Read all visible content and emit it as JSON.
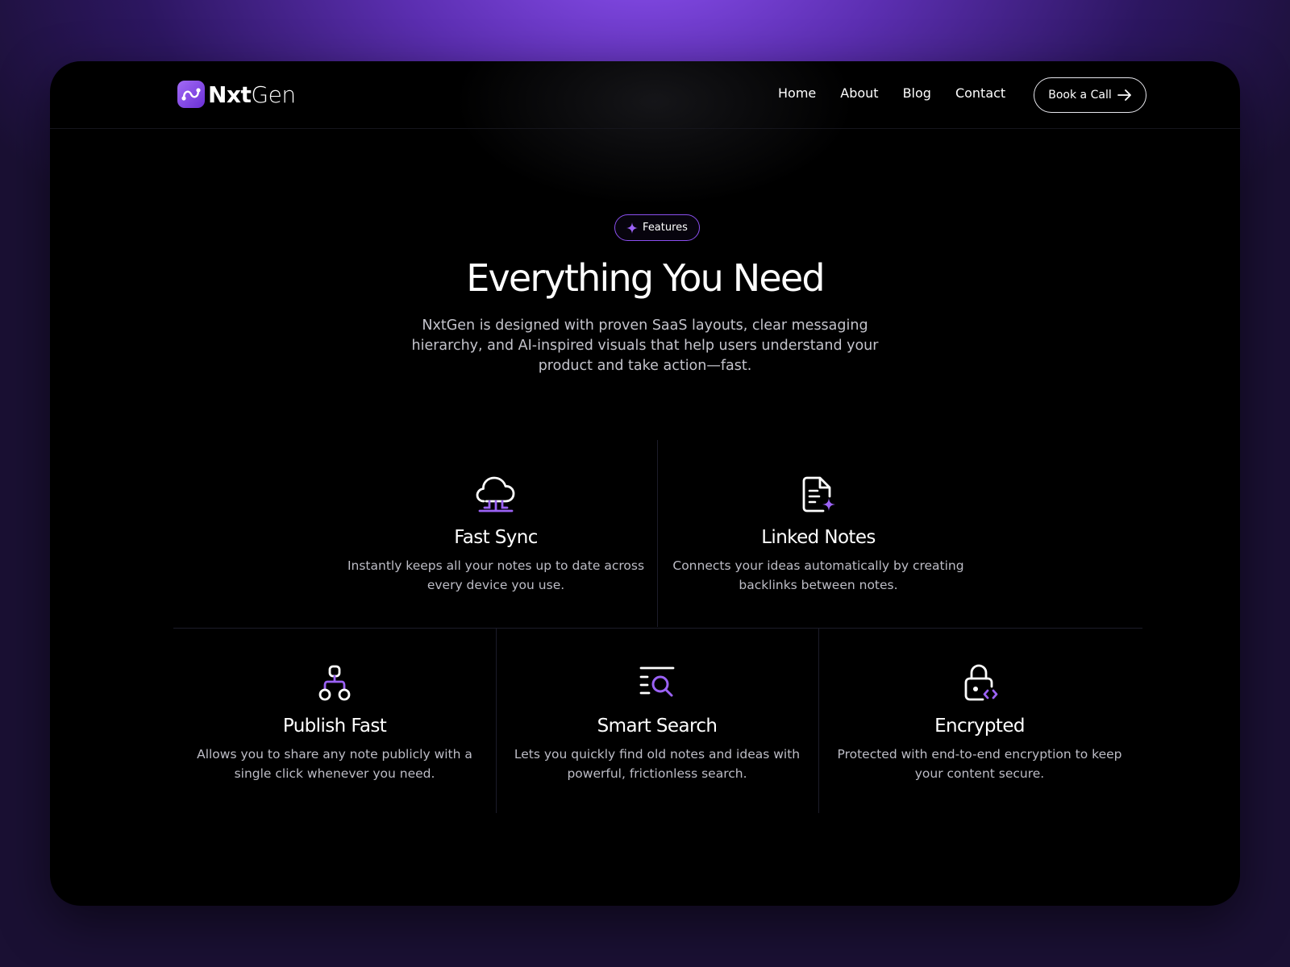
{
  "brand": {
    "name_bold": "Nxt",
    "name_light": "Gen"
  },
  "nav": {
    "links": [
      "Home",
      "About",
      "Blog",
      "Contact"
    ],
    "cta_label": "Book a Call"
  },
  "hero": {
    "badge": "Features",
    "title": "Everything You Need",
    "subtitle": "NxtGen is designed with proven SaaS layouts, clear messaging hierarchy, and AI-inspired visuals that help users understand your product and take action—fast."
  },
  "features": [
    {
      "icon": "cloud-sync-icon",
      "title": "Fast Sync",
      "description": "Instantly keeps all your notes up to date across every device you use."
    },
    {
      "icon": "document-sparkle-icon",
      "title": "Linked Notes",
      "description": "Connects your ideas automatically by creating backlinks between notes."
    },
    {
      "icon": "network-tree-icon",
      "title": "Publish Fast",
      "description": "Allows you to share any note publicly with a single click whenever you need."
    },
    {
      "icon": "search-list-icon",
      "title": "Smart Search",
      "description": "Lets you quickly find old notes and ideas with powerful, frictionless search."
    },
    {
      "icon": "lock-code-icon",
      "title": "Encrypted",
      "description": "Protected with end-to-end encryption to keep your content secure."
    }
  ],
  "colors": {
    "accent": "#8b4ff0",
    "background": "#000000",
    "text": "#ffffff",
    "muted": "#bdbdc6"
  }
}
